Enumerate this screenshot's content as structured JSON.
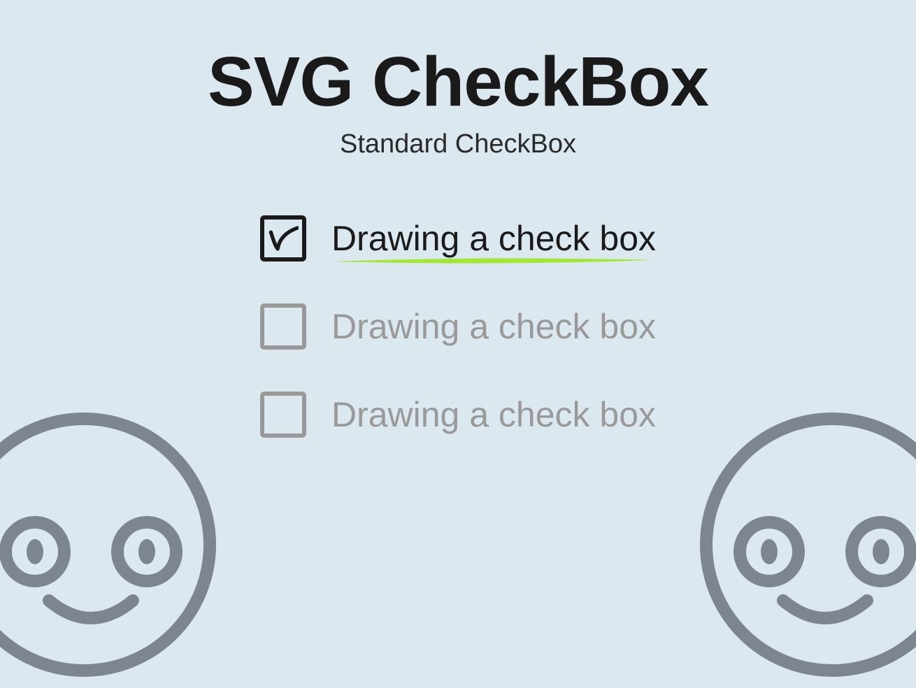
{
  "title": "SVG CheckBox",
  "subtitle": "Standard CheckBox",
  "items": [
    {
      "label": "Drawing a check box",
      "checked": true
    },
    {
      "label": "Drawing a check box",
      "checked": false
    },
    {
      "label": "Drawing a check box",
      "checked": false
    }
  ],
  "colors": {
    "background": "#dce8f0",
    "active": "#1a1a1a",
    "inactive": "#999999",
    "highlight": "#A4E636"
  }
}
